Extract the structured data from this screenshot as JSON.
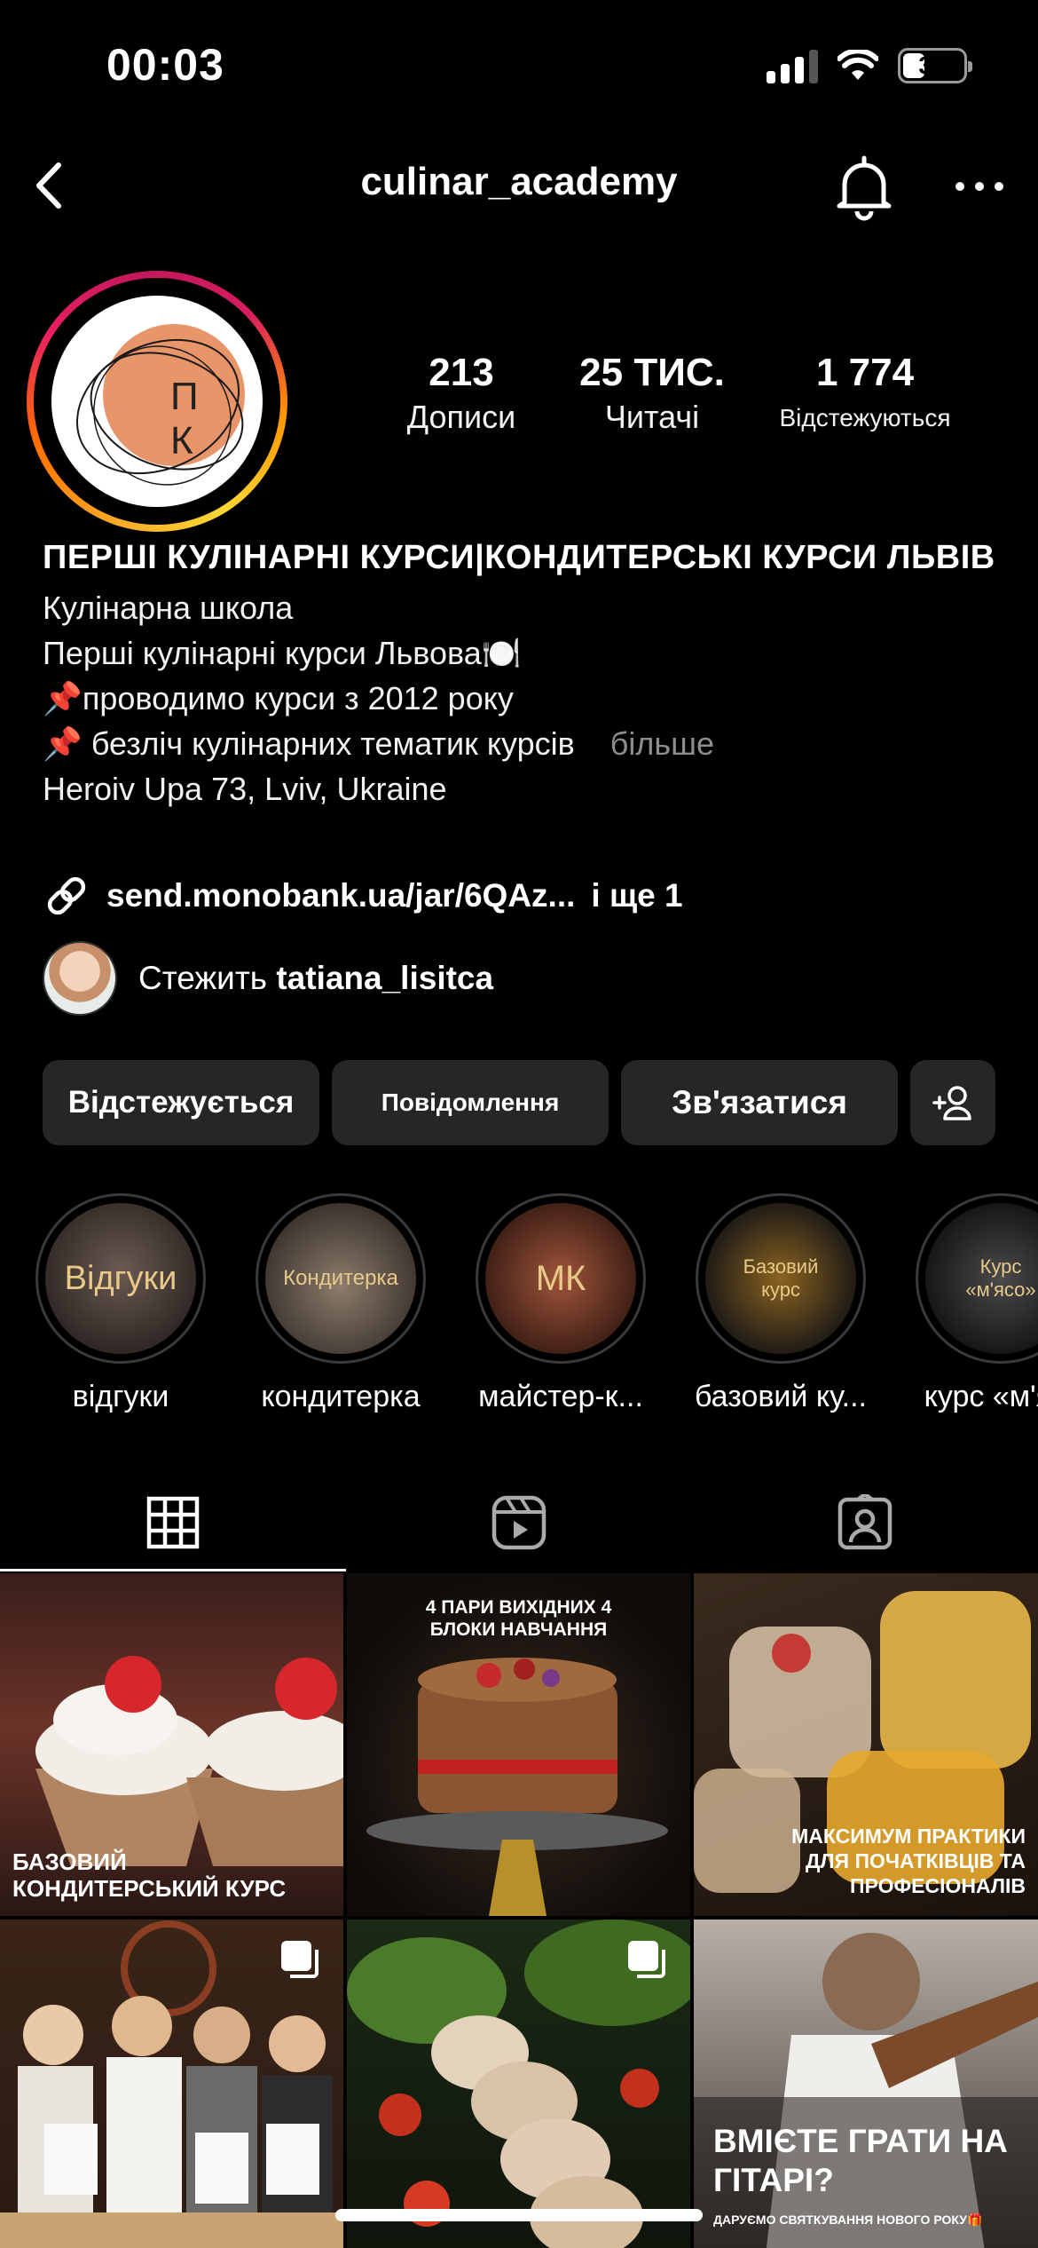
{
  "status_bar": {
    "time": "00:03",
    "battery": "37",
    "battery_level": 0.37
  },
  "nav": {
    "username": "culinar_academy"
  },
  "avatar": {
    "monogram_top": "П",
    "monogram_bottom": "К"
  },
  "stats": [
    {
      "value": "213",
      "label": "Дописи"
    },
    {
      "value": "25 ТИС.",
      "label": "Читачі"
    },
    {
      "value": "1 774",
      "label": "Відстежуються"
    }
  ],
  "bio": {
    "name": "ПЕРШІ КУЛІНАРНІ КУРСИ|КОНДИТЕРСЬКІ КУРСИ ЛЬВІВ",
    "category": "Кулінарна школа",
    "line1": "Перші кулінарні курси Львова🍽️",
    "line2": "📌проводимо курси з 2012 року",
    "line3": "📌 безліч кулінарних тематик курсів",
    "more": "більше",
    "address": "Heroiv Upa 73, Lviv, Ukraine"
  },
  "link": {
    "url": "send.monobank.ua/jar/6QAz...",
    "extra": "і ще 1"
  },
  "followed_by": {
    "prefix": "Стежить",
    "user": "tatiana_lisitca"
  },
  "buttons": {
    "following": "Відстежується",
    "message": "Повідомлення",
    "contact": "Зв'язатися"
  },
  "highlights": [
    {
      "label": "відгуки",
      "cover_text": "Відгуки"
    },
    {
      "label": "кондитерка",
      "cover_text": "Кондитерка"
    },
    {
      "label": "майстер-к...",
      "cover_text": "МК"
    },
    {
      "label": "базовий ку...",
      "cover_text": "Базовий курс"
    },
    {
      "label": "курс «м'я...",
      "cover_text": "Курс «м'ясо»"
    }
  ],
  "posts": [
    {
      "caption": "БАЗОВИЙ КОНДИТЕРСЬКИЙ КУРС"
    },
    {
      "caption": "4 ПАРИ ВИХІДНИХ 4 БЛОКИ НАВЧАННЯ"
    },
    {
      "caption": "МАКСИМУМ ПРАКТИКИ ДЛЯ ПОЧАТКІВЦІВ ТА ПРОФЕСІОНАЛІВ"
    },
    {
      "caption": ""
    },
    {
      "caption": ""
    },
    {
      "caption": "ВМІЄТЕ ГРАТИ НА ГІТАРІ?",
      "subcaption": "ДАРУЄМО СВЯТКУВАННЯ НОВОГО РОКУ🎁"
    }
  ],
  "colors": {
    "accent_avatar": "#e8956a",
    "button_bg": "#262626",
    "muted_text": "#8e8e8e",
    "highlight_text": "#e8c98a"
  }
}
